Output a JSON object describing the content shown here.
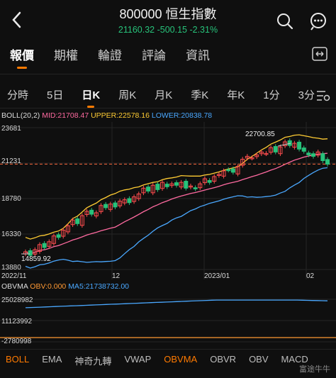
{
  "header": {
    "code_name": "800000 恒生指數",
    "quote": "21160.32  -500.15  -2.31%",
    "back_icon": "chevron-left-icon",
    "search_icon": "search-icon",
    "more_icon": "more-dots-icon"
  },
  "main_tabs": [
    "報價",
    "期權",
    "輪證",
    "評論",
    "資訊"
  ],
  "period_tabs": [
    "分時",
    "5日",
    "日K",
    "周K",
    "月K",
    "季K",
    "年K",
    "1分",
    "3分"
  ],
  "settings_icon": "chart-settings-icon",
  "boll_legend": {
    "name": "BOLL(20,2)",
    "mid": "MID:21708.47",
    "upper": "UPPER:22578.16",
    "lower": "LOWER:20838.78"
  },
  "price_axis": [
    "23681",
    "21231",
    "18780",
    "16330",
    "13880"
  ],
  "price_annotations": {
    "high": "22700.85",
    "low": "14859.92"
  },
  "date_axis": [
    "2022/11",
    "12",
    "2023/01",
    "02"
  ],
  "vol_legend": {
    "name": "OBVMA",
    "obv": "OBV:0.000",
    "ma5": "MA5:21738732.00"
  },
  "vol_axis": [
    "25028982",
    "11123992",
    "-2780998"
  ],
  "indicator_tabs": [
    "BOLL",
    "EMA",
    "神奇九轉",
    "VWAP",
    "OBVMA",
    "OBVR",
    "OBV",
    "MACD"
  ],
  "watermark": "富途牛牛",
  "colors": {
    "up": "#ff4d4f",
    "down": "#27c27a",
    "mid": "#ff6aa0",
    "upper": "#ffcc33",
    "lower": "#4aa8ff",
    "accent": "#ff7a00"
  },
  "chart_data": {
    "type": "candlestick",
    "indicator": "BOLL(20,2)",
    "y_axis_ticks": [
      23681,
      21231,
      18780,
      16330,
      13880
    ],
    "x_axis_ticks": [
      "2022/11",
      "12",
      "2023/01",
      "02"
    ],
    "last_price": 21160.32,
    "change": -500.15,
    "change_pct": -2.31,
    "annotated_high": 22700.85,
    "annotated_low": 14859.92,
    "closes": [
      15100,
      14860,
      15250,
      15600,
      15400,
      15800,
      16200,
      16100,
      16600,
      16900,
      17300,
      17050,
      17600,
      17900,
      17700,
      17800,
      18300,
      18150,
      18400,
      18200,
      18600,
      18700,
      18500,
      18900,
      19100,
      19500,
      19300,
      19700,
      19400,
      19900,
      19600,
      19800,
      19700,
      19900,
      19500,
      19650,
      19450,
      19800,
      20150,
      19900,
      20300,
      20450,
      20700,
      20750,
      20600,
      21000,
      21500,
      21700,
      21600,
      21800,
      22000,
      21900,
      22300,
      22000,
      22350,
      22700,
      22450,
      22600,
      22200,
      22050,
      21800,
      21700,
      22000,
      21400,
      21160
    ]
  }
}
